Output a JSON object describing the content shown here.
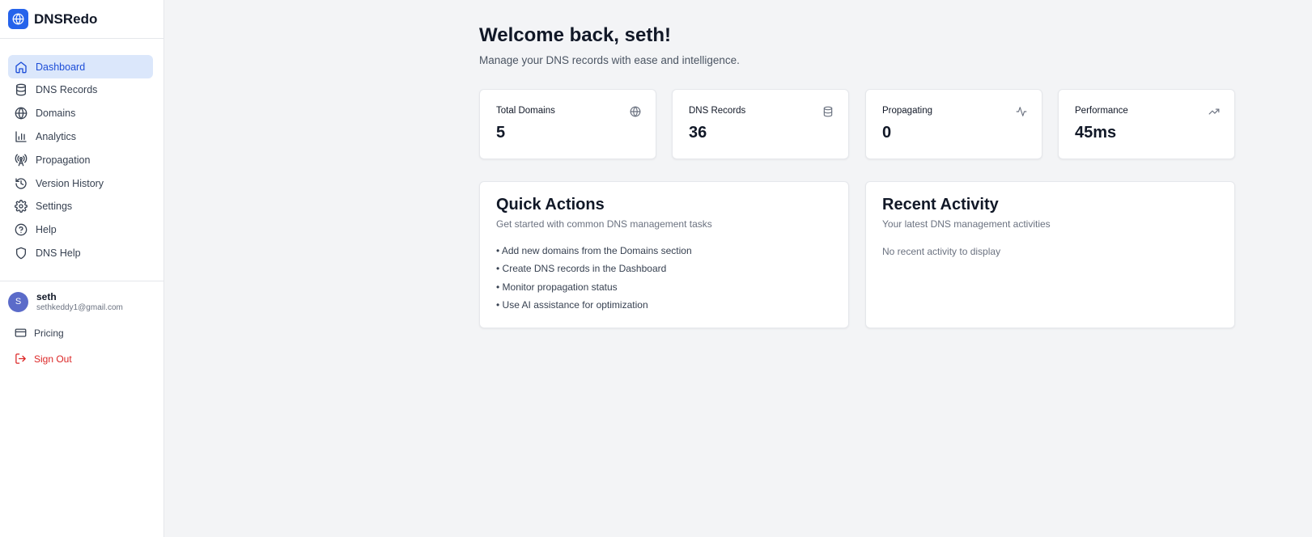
{
  "brand": {
    "name": "DNSRedo",
    "accent": "#2563eb"
  },
  "sidebar": {
    "items": [
      {
        "label": "Dashboard",
        "icon": "home-icon",
        "active": true
      },
      {
        "label": "DNS Records",
        "icon": "database-icon"
      },
      {
        "label": "Domains",
        "icon": "globe-icon"
      },
      {
        "label": "Analytics",
        "icon": "bar-chart-icon"
      },
      {
        "label": "Propagation",
        "icon": "radio-tower-icon"
      },
      {
        "label": "Version History",
        "icon": "history-icon"
      },
      {
        "label": "Settings",
        "icon": "gear-icon"
      },
      {
        "label": "Help",
        "icon": "help-circle-icon"
      },
      {
        "label": "DNS Help",
        "icon": "shield-icon"
      }
    ]
  },
  "user": {
    "initial": "S",
    "name": "seth",
    "email": "sethkeddy1@gmail.com"
  },
  "bottom_links": {
    "pricing": "Pricing",
    "sign_out": "Sign Out"
  },
  "main": {
    "title": "Welcome back, seth!",
    "subtitle": "Manage your DNS records with ease and intelligence."
  },
  "stats": [
    {
      "label": "Total Domains",
      "value": "5",
      "icon": "globe-icon"
    },
    {
      "label": "DNS Records",
      "value": "36",
      "icon": "database-icon"
    },
    {
      "label": "Propagating",
      "value": "0",
      "icon": "activity-icon"
    },
    {
      "label": "Performance",
      "value": "45ms",
      "icon": "trending-up-icon"
    }
  ],
  "quick_actions": {
    "title": "Quick Actions",
    "subtitle": "Get started with common DNS management tasks",
    "items": [
      "• Add new domains from the Domains section",
      "• Create DNS records in the Dashboard",
      "• Monitor propagation status",
      "• Use AI assistance for optimization"
    ]
  },
  "recent_activity": {
    "title": "Recent Activity",
    "subtitle": "Your latest DNS management activities",
    "empty": "No recent activity to display"
  }
}
